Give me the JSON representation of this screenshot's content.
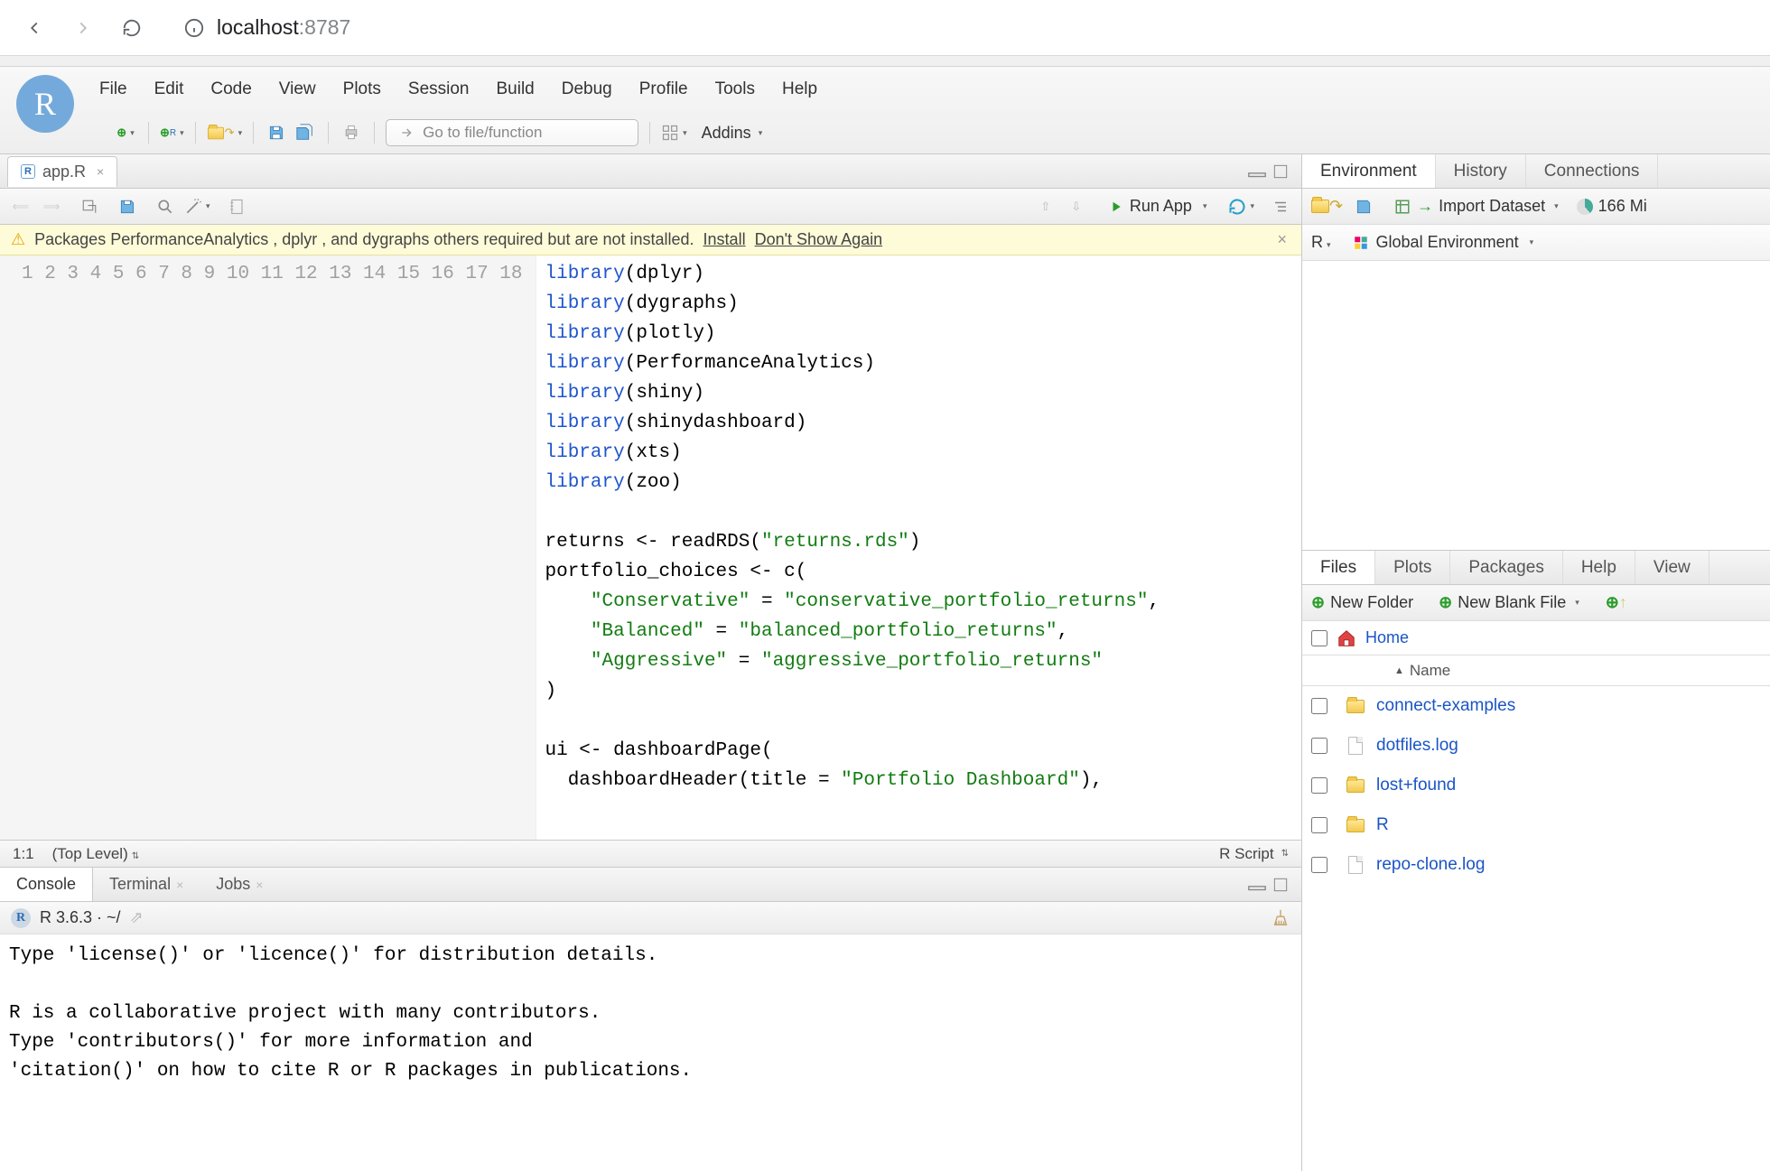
{
  "browser": {
    "url_host": "localhost",
    "url_port": ":8787"
  },
  "menus": [
    "File",
    "Edit",
    "Code",
    "View",
    "Plots",
    "Session",
    "Build",
    "Debug",
    "Profile",
    "Tools",
    "Help"
  ],
  "goto_placeholder": "Go to file/function",
  "addins_label": "Addins",
  "source": {
    "tab_name": "app.R",
    "runapp_label": "Run App",
    "warning_text": "Packages PerformanceAnalytics , dplyr , and dygraphs others required but are not installed.",
    "warning_install": "Install",
    "warning_dontshow": "Don't Show Again",
    "status_pos": "1:1",
    "status_scope": "(Top Level)",
    "status_type": "R Script",
    "code_lines": [
      [
        [
          "kw",
          "library"
        ],
        [
          "fn",
          "(dplyr)"
        ]
      ],
      [
        [
          "kw",
          "library"
        ],
        [
          "fn",
          "(dygraphs)"
        ]
      ],
      [
        [
          "kw",
          "library"
        ],
        [
          "fn",
          "(plotly)"
        ]
      ],
      [
        [
          "kw",
          "library"
        ],
        [
          "fn",
          "(PerformanceAnalytics)"
        ]
      ],
      [
        [
          "kw",
          "library"
        ],
        [
          "fn",
          "(shiny)"
        ]
      ],
      [
        [
          "kw",
          "library"
        ],
        [
          "fn",
          "(shinydashboard)"
        ]
      ],
      [
        [
          "kw",
          "library"
        ],
        [
          "fn",
          "(xts)"
        ]
      ],
      [
        [
          "kw",
          "library"
        ],
        [
          "fn",
          "(zoo)"
        ]
      ],
      [
        [
          "fn",
          ""
        ]
      ],
      [
        [
          "fn",
          "returns <- readRDS("
        ],
        [
          "str",
          "\"returns.rds\""
        ],
        [
          "fn",
          ")"
        ]
      ],
      [
        [
          "fn",
          "portfolio_choices <- c("
        ]
      ],
      [
        [
          "fn",
          "    "
        ],
        [
          "str",
          "\"Conservative\""
        ],
        [
          "fn",
          " = "
        ],
        [
          "str",
          "\"conservative_portfolio_returns\""
        ],
        [
          "fn",
          ","
        ]
      ],
      [
        [
          "fn",
          "    "
        ],
        [
          "str",
          "\"Balanced\""
        ],
        [
          "fn",
          " = "
        ],
        [
          "str",
          "\"balanced_portfolio_returns\""
        ],
        [
          "fn",
          ","
        ]
      ],
      [
        [
          "fn",
          "    "
        ],
        [
          "str",
          "\"Aggressive\""
        ],
        [
          "fn",
          " = "
        ],
        [
          "str",
          "\"aggressive_portfolio_returns\""
        ]
      ],
      [
        [
          "fn",
          ")"
        ]
      ],
      [
        [
          "fn",
          ""
        ]
      ],
      [
        [
          "fn",
          "ui <- dashboardPage("
        ]
      ],
      [
        [
          "fn",
          "  dashboardHeader(title = "
        ],
        [
          "str",
          "\"Portfolio Dashboard\""
        ],
        [
          "fn",
          "),"
        ]
      ]
    ]
  },
  "console": {
    "tabs": [
      "Console",
      "Terminal",
      "Jobs"
    ],
    "info": "R 3.6.3 · ~/",
    "body": "Type 'license()' or 'licence()' for distribution details.\n\nR is a collaborative project with many contributors.\nType 'contributors()' for more information and\n'citation()' on how to cite R or R packages in publications."
  },
  "env": {
    "tabs": [
      "Environment",
      "History",
      "Connections"
    ],
    "import_label": "Import Dataset",
    "mem_label": "166 Mi",
    "lang_label": "R",
    "scope_label": "Global Environment"
  },
  "files": {
    "tabs": [
      "Files",
      "Plots",
      "Packages",
      "Help",
      "View"
    ],
    "new_folder": "New Folder",
    "new_blank": "New Blank File",
    "path_label": "Home",
    "name_header": "Name",
    "items": [
      {
        "type": "folder",
        "name": "connect-examples"
      },
      {
        "type": "file",
        "name": "dotfiles.log"
      },
      {
        "type": "folder",
        "name": "lost+found"
      },
      {
        "type": "folder",
        "name": "R"
      },
      {
        "type": "file",
        "name": "repo-clone.log"
      }
    ]
  }
}
